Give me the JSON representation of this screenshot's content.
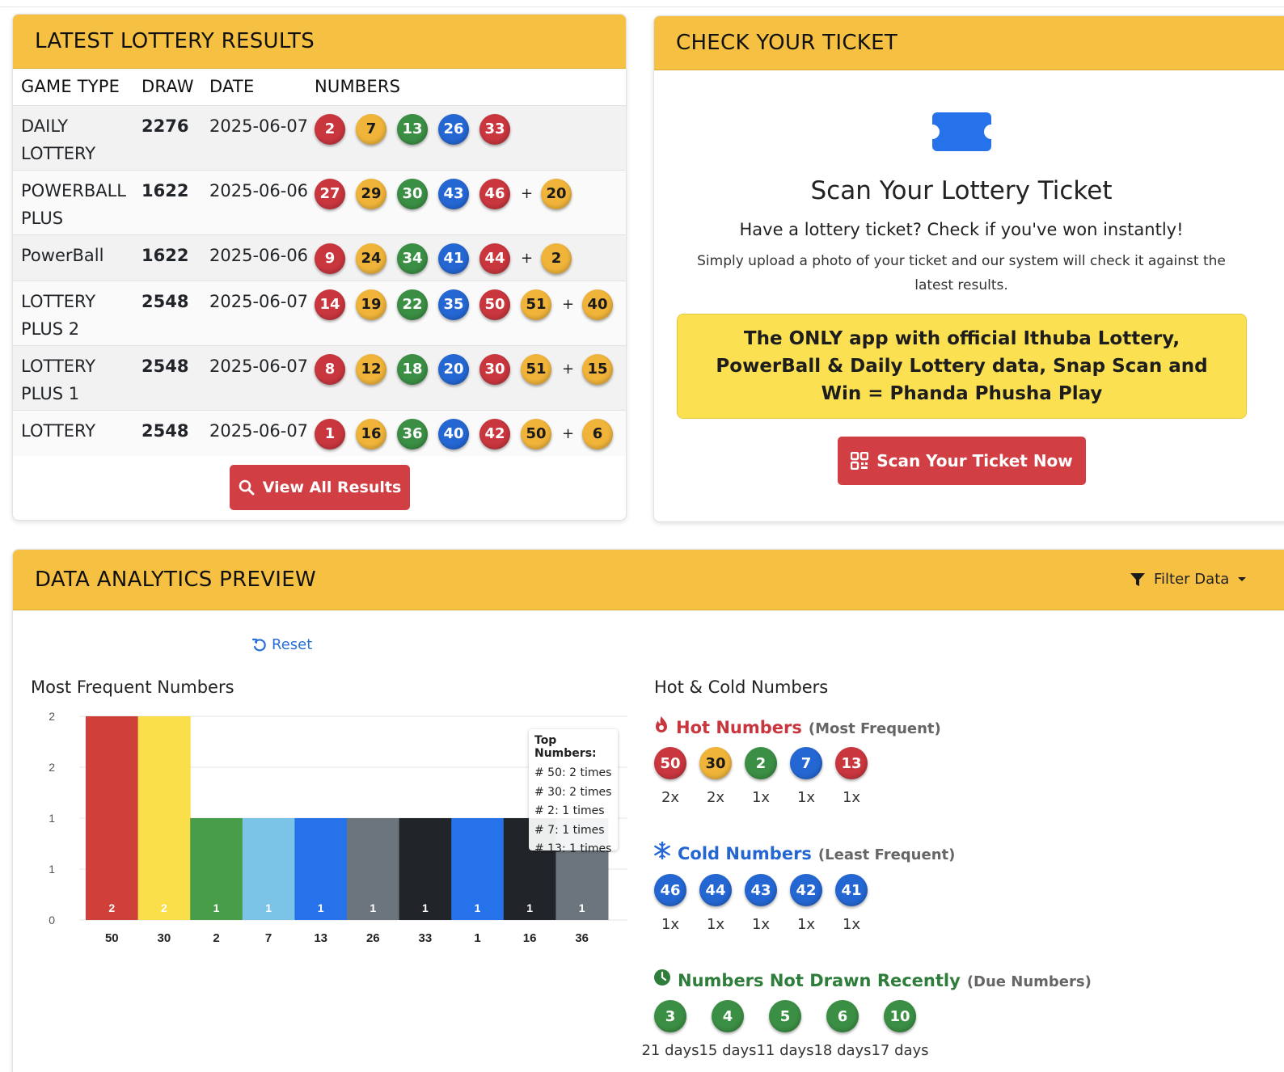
{
  "results": {
    "title": "LATEST LOTTERY RESULTS",
    "columns": [
      "GAME TYPE",
      "DRAW",
      "DATE",
      "NUMBERS"
    ],
    "rows": [
      {
        "game": "DAILY LOTTERY",
        "draw": "2276",
        "date": "2025-06-07",
        "balls": [
          {
            "n": "2",
            "c": "red"
          },
          {
            "n": "7",
            "c": "yellow"
          },
          {
            "n": "13",
            "c": "green"
          },
          {
            "n": "26",
            "c": "blue"
          },
          {
            "n": "33",
            "c": "red"
          }
        ],
        "bonus": null
      },
      {
        "game": "POWERBALL PLUS",
        "draw": "1622",
        "date": "2025-06-06",
        "balls": [
          {
            "n": "27",
            "c": "red"
          },
          {
            "n": "29",
            "c": "yellow"
          },
          {
            "n": "30",
            "c": "green"
          },
          {
            "n": "43",
            "c": "blue"
          },
          {
            "n": "46",
            "c": "red"
          }
        ],
        "bonus": {
          "n": "20",
          "c": "yellow"
        }
      },
      {
        "game": "PowerBall",
        "draw": "1622",
        "date": "2025-06-06",
        "balls": [
          {
            "n": "9",
            "c": "red"
          },
          {
            "n": "24",
            "c": "yellow"
          },
          {
            "n": "34",
            "c": "green"
          },
          {
            "n": "41",
            "c": "blue"
          },
          {
            "n": "44",
            "c": "red"
          }
        ],
        "bonus": {
          "n": "2",
          "c": "yellow"
        }
      },
      {
        "game": "LOTTERY PLUS 2",
        "draw": "2548",
        "date": "2025-06-07",
        "balls": [
          {
            "n": "14",
            "c": "red"
          },
          {
            "n": "19",
            "c": "yellow"
          },
          {
            "n": "22",
            "c": "green"
          },
          {
            "n": "35",
            "c": "blue"
          },
          {
            "n": "50",
            "c": "red"
          },
          {
            "n": "51",
            "c": "yellow"
          }
        ],
        "bonus": {
          "n": "40",
          "c": "yellow"
        }
      },
      {
        "game": "LOTTERY PLUS 1",
        "draw": "2548",
        "date": "2025-06-07",
        "balls": [
          {
            "n": "8",
            "c": "red"
          },
          {
            "n": "12",
            "c": "yellow"
          },
          {
            "n": "18",
            "c": "green"
          },
          {
            "n": "20",
            "c": "blue"
          },
          {
            "n": "30",
            "c": "red"
          },
          {
            "n": "51",
            "c": "yellow"
          }
        ],
        "bonus": {
          "n": "15",
          "c": "yellow"
        }
      },
      {
        "game": "LOTTERY",
        "draw": "2548",
        "date": "2025-06-07",
        "balls": [
          {
            "n": "1",
            "c": "red"
          },
          {
            "n": "16",
            "c": "yellow"
          },
          {
            "n": "36",
            "c": "green"
          },
          {
            "n": "40",
            "c": "blue"
          },
          {
            "n": "42",
            "c": "red"
          },
          {
            "n": "50",
            "c": "yellow"
          }
        ],
        "bonus": {
          "n": "6",
          "c": "yellow"
        }
      }
    ],
    "plus_sign": "+",
    "view_all_label": "View All Results",
    "view_all_icon": "search-icon"
  },
  "ticket": {
    "title": "CHECK YOUR TICKET",
    "icon": "ticket-icon",
    "scan_title": "Scan Your Lottery Ticket",
    "subtitle": "Have a lottery ticket? Check if you've won instantly!",
    "description": "Simply upload a photo of your ticket and our system will check it against the latest results.",
    "promo": "The ONLY app with official Ithuba Lottery, PowerBall & Daily Lottery data, Snap Scan and Win = Phanda Phusha Play",
    "button_label": "Scan Your Ticket Now",
    "button_icon": "qr-code-icon"
  },
  "analytics": {
    "title": "DATA ANALYTICS PREVIEW",
    "filter_label": "Filter Data",
    "reset_label": "Reset",
    "frequent_title": "Most Frequent Numbers",
    "hotcold_title": "Hot & Cold Numbers",
    "hot": {
      "label": "Hot Numbers",
      "sub": "(Most Frequent)",
      "color": "#c9363e",
      "items": [
        {
          "n": "50",
          "c": "red",
          "count": "2x"
        },
        {
          "n": "30",
          "c": "yellow",
          "count": "2x"
        },
        {
          "n": "2",
          "c": "green",
          "count": "1x"
        },
        {
          "n": "7",
          "c": "blue",
          "count": "1x"
        },
        {
          "n": "13",
          "c": "red",
          "count": "1x"
        }
      ]
    },
    "cold": {
      "label": "Cold Numbers",
      "sub": "(Least Frequent)",
      "color": "#2467d3",
      "items": [
        {
          "n": "46",
          "c": "blue",
          "count": "1x"
        },
        {
          "n": "44",
          "c": "blue",
          "count": "1x"
        },
        {
          "n": "43",
          "c": "blue",
          "count": "1x"
        },
        {
          "n": "42",
          "c": "blue",
          "count": "1x"
        },
        {
          "n": "41",
          "c": "blue",
          "count": "1x"
        }
      ]
    },
    "due": {
      "label": "Numbers Not Drawn Recently",
      "sub": "(Due Numbers)",
      "color": "#2e7d3b",
      "items": [
        {
          "n": "3",
          "c": "green",
          "count": "21 days"
        },
        {
          "n": "4",
          "c": "green",
          "count": "15 days"
        },
        {
          "n": "5",
          "c": "green",
          "count": "11 days"
        },
        {
          "n": "6",
          "c": "green",
          "count": "18 days"
        },
        {
          "n": "10",
          "c": "green",
          "count": "17 days"
        }
      ]
    },
    "tooltip": {
      "title": "Top Numbers:",
      "lines": [
        "# 50: 2 times",
        "# 30: 2 times",
        "# 2: 1 times",
        "# 7: 1 times",
        "# 13: 1 times"
      ]
    }
  },
  "chart_data": {
    "type": "bar",
    "title": "Most Frequent Numbers",
    "categories": [
      "50",
      "30",
      "2",
      "7",
      "13",
      "26",
      "33",
      "1",
      "16",
      "36"
    ],
    "values": [
      2,
      2,
      1,
      1,
      1,
      1,
      1,
      1,
      1,
      1
    ],
    "bar_colors": [
      "#d0403b",
      "#fadf4a",
      "#479d48",
      "#7bc4e8",
      "#2672ea",
      "#6c757d",
      "#212529",
      "#2672ea",
      "#212529",
      "#6c757d"
    ],
    "ylim": [
      0,
      2
    ],
    "yticks": [
      "0",
      "1",
      "1",
      "2",
      "2"
    ],
    "grid": true,
    "xlabel": "",
    "ylabel": ""
  },
  "colors": {
    "red": "#c9363e",
    "yellow": "#f0b43a",
    "green": "#3b8f44",
    "blue": "#2467d3",
    "header": "#f6c142",
    "button": "#d13f44"
  }
}
